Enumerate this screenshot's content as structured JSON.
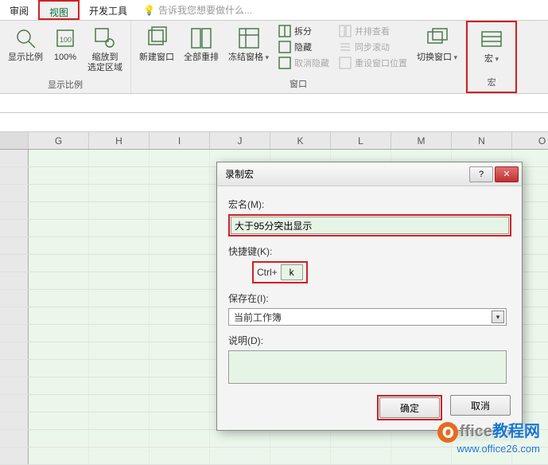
{
  "tabs": {
    "review": "审阅",
    "view": "视图",
    "dev": "开发工具",
    "tellme": "告诉我您想要做什么..."
  },
  "ribbon": {
    "zoom_group": "显示比例",
    "zoom_btn": "显示比例",
    "zoom100": "100%",
    "zoom_sel": "缩放到\n选定区域",
    "window_group": "窗口",
    "new_window": "新建窗口",
    "arrange": "全部重排",
    "freeze": "冻结窗格",
    "split": "拆分",
    "hide": "隐藏",
    "unhide": "取消隐藏",
    "side": "并排查看",
    "sync": "同步滚动",
    "reset": "重设窗口位置",
    "switch": "切换窗口",
    "macro_group": "宏",
    "macro": "宏"
  },
  "columns": [
    "",
    "G",
    "H",
    "I",
    "J",
    "K",
    "L",
    "M",
    "N",
    "O"
  ],
  "dialog": {
    "title": "录制宏",
    "name_label": "宏名(M):",
    "name_value": "大于95分突出显示",
    "shortcut_label": "快捷键(K):",
    "shortcut_prefix": "Ctrl+",
    "shortcut_value": "k",
    "save_label": "保存在(I):",
    "save_value": "当前工作簿",
    "desc_label": "说明(D):",
    "ok": "确定",
    "cancel": "取消"
  },
  "watermark": {
    "brand_left": "ffice",
    "brand_right": "教程网",
    "url": "www.office26.com"
  }
}
